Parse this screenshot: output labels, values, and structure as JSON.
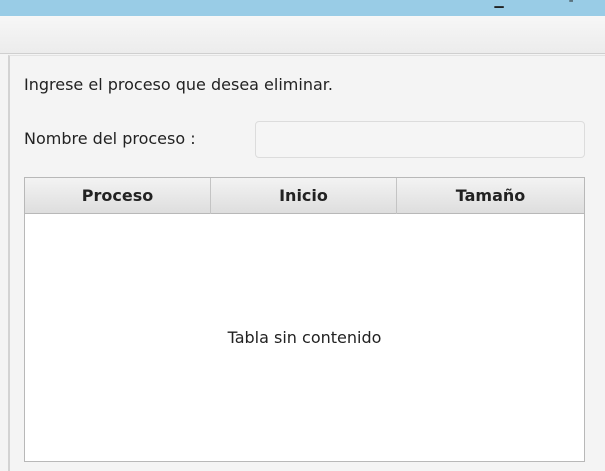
{
  "titlebar": {
    "minimize_glyph": "▁",
    "extra_glyph": "╴",
    "accent_color": "#99cce6"
  },
  "form": {
    "instruction": "Ingrese el proceso que desea eliminar.",
    "name_label": "Nombre del proceso :",
    "name_value": "",
    "name_placeholder": ""
  },
  "table": {
    "columns": [
      "Proceso",
      "Inicio",
      "Tamaño"
    ],
    "rows": [],
    "empty_text": "Tabla sin contenido"
  }
}
